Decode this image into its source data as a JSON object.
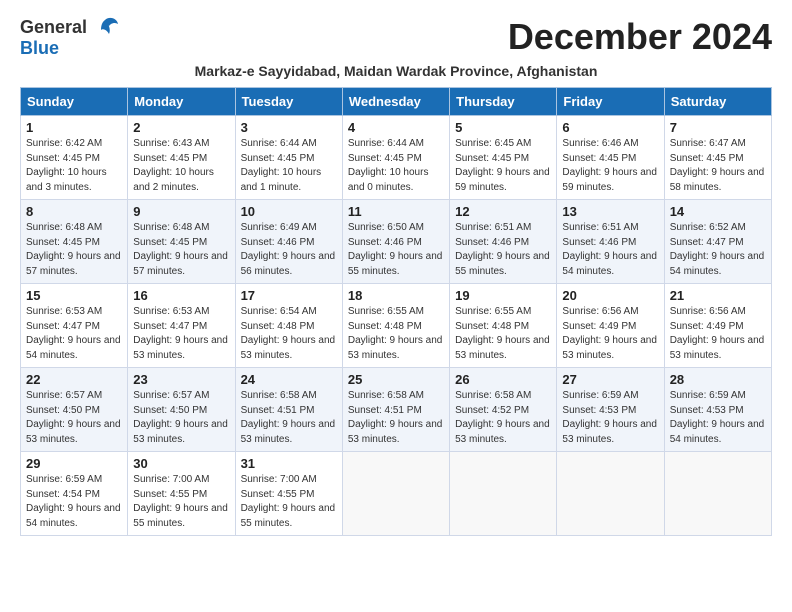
{
  "header": {
    "logo_general": "General",
    "logo_blue": "Blue",
    "month_title": "December 2024",
    "subtitle": "Markaz-e Sayyidabad, Maidan Wardak Province, Afghanistan"
  },
  "weekdays": [
    "Sunday",
    "Monday",
    "Tuesday",
    "Wednesday",
    "Thursday",
    "Friday",
    "Saturday"
  ],
  "weeks": [
    [
      {
        "day": "1",
        "sunrise": "Sunrise: 6:42 AM",
        "sunset": "Sunset: 4:45 PM",
        "daylight": "Daylight: 10 hours and 3 minutes."
      },
      {
        "day": "2",
        "sunrise": "Sunrise: 6:43 AM",
        "sunset": "Sunset: 4:45 PM",
        "daylight": "Daylight: 10 hours and 2 minutes."
      },
      {
        "day": "3",
        "sunrise": "Sunrise: 6:44 AM",
        "sunset": "Sunset: 4:45 PM",
        "daylight": "Daylight: 10 hours and 1 minute."
      },
      {
        "day": "4",
        "sunrise": "Sunrise: 6:44 AM",
        "sunset": "Sunset: 4:45 PM",
        "daylight": "Daylight: 10 hours and 0 minutes."
      },
      {
        "day": "5",
        "sunrise": "Sunrise: 6:45 AM",
        "sunset": "Sunset: 4:45 PM",
        "daylight": "Daylight: 9 hours and 59 minutes."
      },
      {
        "day": "6",
        "sunrise": "Sunrise: 6:46 AM",
        "sunset": "Sunset: 4:45 PM",
        "daylight": "Daylight: 9 hours and 59 minutes."
      },
      {
        "day": "7",
        "sunrise": "Sunrise: 6:47 AM",
        "sunset": "Sunset: 4:45 PM",
        "daylight": "Daylight: 9 hours and 58 minutes."
      }
    ],
    [
      {
        "day": "8",
        "sunrise": "Sunrise: 6:48 AM",
        "sunset": "Sunset: 4:45 PM",
        "daylight": "Daylight: 9 hours and 57 minutes."
      },
      {
        "day": "9",
        "sunrise": "Sunrise: 6:48 AM",
        "sunset": "Sunset: 4:45 PM",
        "daylight": "Daylight: 9 hours and 57 minutes."
      },
      {
        "day": "10",
        "sunrise": "Sunrise: 6:49 AM",
        "sunset": "Sunset: 4:46 PM",
        "daylight": "Daylight: 9 hours and 56 minutes."
      },
      {
        "day": "11",
        "sunrise": "Sunrise: 6:50 AM",
        "sunset": "Sunset: 4:46 PM",
        "daylight": "Daylight: 9 hours and 55 minutes."
      },
      {
        "day": "12",
        "sunrise": "Sunrise: 6:51 AM",
        "sunset": "Sunset: 4:46 PM",
        "daylight": "Daylight: 9 hours and 55 minutes."
      },
      {
        "day": "13",
        "sunrise": "Sunrise: 6:51 AM",
        "sunset": "Sunset: 4:46 PM",
        "daylight": "Daylight: 9 hours and 54 minutes."
      },
      {
        "day": "14",
        "sunrise": "Sunrise: 6:52 AM",
        "sunset": "Sunset: 4:47 PM",
        "daylight": "Daylight: 9 hours and 54 minutes."
      }
    ],
    [
      {
        "day": "15",
        "sunrise": "Sunrise: 6:53 AM",
        "sunset": "Sunset: 4:47 PM",
        "daylight": "Daylight: 9 hours and 54 minutes."
      },
      {
        "day": "16",
        "sunrise": "Sunrise: 6:53 AM",
        "sunset": "Sunset: 4:47 PM",
        "daylight": "Daylight: 9 hours and 53 minutes."
      },
      {
        "day": "17",
        "sunrise": "Sunrise: 6:54 AM",
        "sunset": "Sunset: 4:48 PM",
        "daylight": "Daylight: 9 hours and 53 minutes."
      },
      {
        "day": "18",
        "sunrise": "Sunrise: 6:55 AM",
        "sunset": "Sunset: 4:48 PM",
        "daylight": "Daylight: 9 hours and 53 minutes."
      },
      {
        "day": "19",
        "sunrise": "Sunrise: 6:55 AM",
        "sunset": "Sunset: 4:48 PM",
        "daylight": "Daylight: 9 hours and 53 minutes."
      },
      {
        "day": "20",
        "sunrise": "Sunrise: 6:56 AM",
        "sunset": "Sunset: 4:49 PM",
        "daylight": "Daylight: 9 hours and 53 minutes."
      },
      {
        "day": "21",
        "sunrise": "Sunrise: 6:56 AM",
        "sunset": "Sunset: 4:49 PM",
        "daylight": "Daylight: 9 hours and 53 minutes."
      }
    ],
    [
      {
        "day": "22",
        "sunrise": "Sunrise: 6:57 AM",
        "sunset": "Sunset: 4:50 PM",
        "daylight": "Daylight: 9 hours and 53 minutes."
      },
      {
        "day": "23",
        "sunrise": "Sunrise: 6:57 AM",
        "sunset": "Sunset: 4:50 PM",
        "daylight": "Daylight: 9 hours and 53 minutes."
      },
      {
        "day": "24",
        "sunrise": "Sunrise: 6:58 AM",
        "sunset": "Sunset: 4:51 PM",
        "daylight": "Daylight: 9 hours and 53 minutes."
      },
      {
        "day": "25",
        "sunrise": "Sunrise: 6:58 AM",
        "sunset": "Sunset: 4:51 PM",
        "daylight": "Daylight: 9 hours and 53 minutes."
      },
      {
        "day": "26",
        "sunrise": "Sunrise: 6:58 AM",
        "sunset": "Sunset: 4:52 PM",
        "daylight": "Daylight: 9 hours and 53 minutes."
      },
      {
        "day": "27",
        "sunrise": "Sunrise: 6:59 AM",
        "sunset": "Sunset: 4:53 PM",
        "daylight": "Daylight: 9 hours and 53 minutes."
      },
      {
        "day": "28",
        "sunrise": "Sunrise: 6:59 AM",
        "sunset": "Sunset: 4:53 PM",
        "daylight": "Daylight: 9 hours and 54 minutes."
      }
    ],
    [
      {
        "day": "29",
        "sunrise": "Sunrise: 6:59 AM",
        "sunset": "Sunset: 4:54 PM",
        "daylight": "Daylight: 9 hours and 54 minutes."
      },
      {
        "day": "30",
        "sunrise": "Sunrise: 7:00 AM",
        "sunset": "Sunset: 4:55 PM",
        "daylight": "Daylight: 9 hours and 55 minutes."
      },
      {
        "day": "31",
        "sunrise": "Sunrise: 7:00 AM",
        "sunset": "Sunset: 4:55 PM",
        "daylight": "Daylight: 9 hours and 55 minutes."
      },
      null,
      null,
      null,
      null
    ]
  ]
}
